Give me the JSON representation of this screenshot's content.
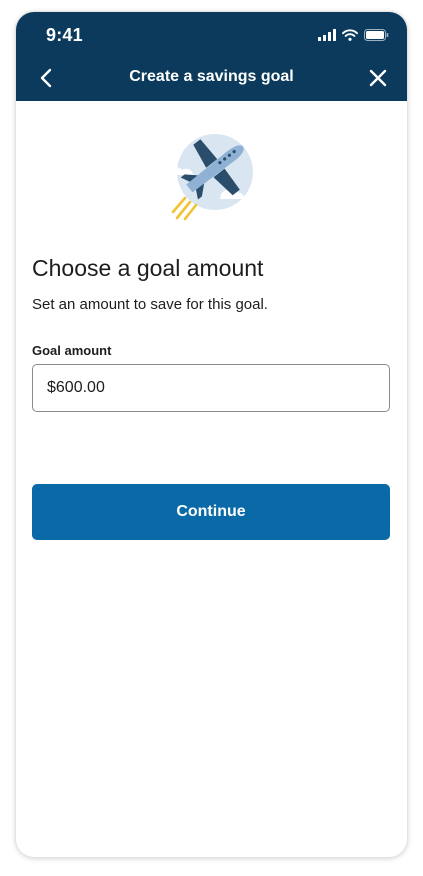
{
  "status_bar": {
    "time": "9:41"
  },
  "header": {
    "title": "Create a savings goal",
    "back_icon": "chevron-left-icon",
    "close_icon": "close-icon"
  },
  "illustration": {
    "icon": "airplane-icon"
  },
  "main": {
    "heading": "Choose a goal amount",
    "subtext": "Set an amount to save for this goal.",
    "goal_amount": {
      "label": "Goal amount",
      "value": "$600.00"
    },
    "continue_label": "Continue"
  },
  "colors": {
    "header_bg": "#0b3a5c",
    "primary_button": "#0a6aa8",
    "illustration_circle": "#d9e6f2"
  }
}
